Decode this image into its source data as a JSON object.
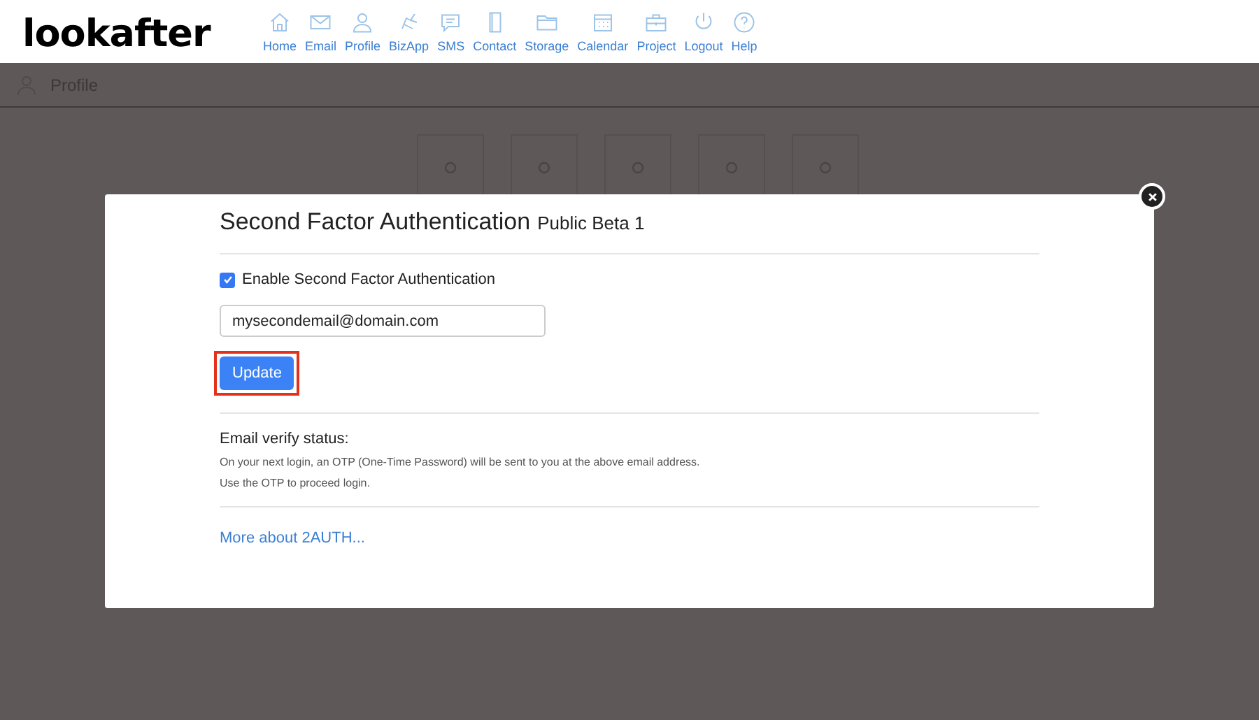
{
  "logo": "lookafter",
  "nav": [
    {
      "label": "Home"
    },
    {
      "label": "Email"
    },
    {
      "label": "Profile"
    },
    {
      "label": "BizApp"
    },
    {
      "label": "SMS"
    },
    {
      "label": "Contact"
    },
    {
      "label": "Storage"
    },
    {
      "label": "Calendar"
    },
    {
      "label": "Project"
    },
    {
      "label": "Logout"
    },
    {
      "label": "Help"
    }
  ],
  "page_title": "Profile",
  "modal": {
    "title": "Second Factor Authentication",
    "title_suffix": "Public Beta 1",
    "enable_checkbox": {
      "label": "Enable Second Factor Authentication",
      "checked": true
    },
    "email_field": {
      "value": "mysecondemail@domain.com"
    },
    "update_button": {
      "label": "Update",
      "highlighted": true
    },
    "status_heading": "Email verify status:",
    "status_lines": [
      "On your next login, an OTP (One-Time Password) will be sent to you at the above email address.",
      "Use the OTP to proceed login."
    ],
    "more_link": "More about 2AUTH..."
  }
}
